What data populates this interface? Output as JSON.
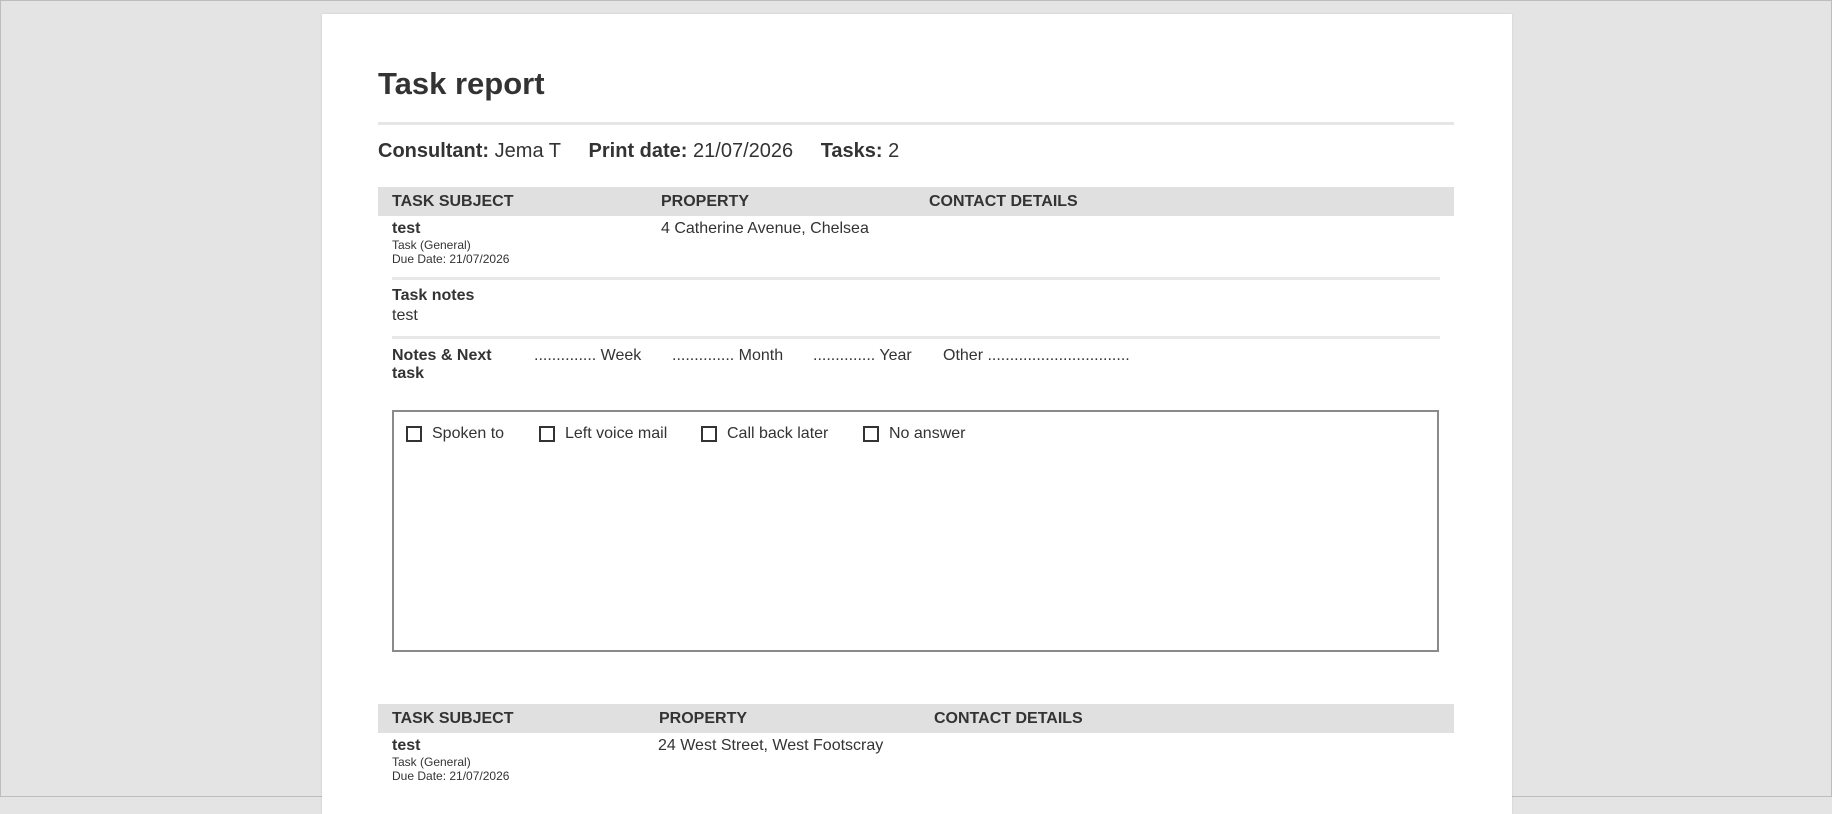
{
  "report": {
    "title": "Task report",
    "consultant_label": "Consultant:",
    "consultant_value": "Jema T",
    "print_date_label": "Print date:",
    "print_date_value": "21/07/2026",
    "tasks_label": "Tasks:",
    "tasks_value": "2"
  },
  "table_headers": [
    "TASK SUBJECT",
    "PROPERTY",
    "CONTACT DETAILS"
  ],
  "tasks": [
    {
      "subject": "test",
      "type": "Task (General)",
      "due": "Due Date: 21/07/2026",
      "property": "4 Catherine Avenue, Chelsea",
      "notes_label": "Task notes",
      "notes": "test",
      "next_label": "Notes & Next task",
      "periods": [
        ".............. Week",
        ".............. Month",
        ".............. Year",
        "Other ................................"
      ],
      "options": [
        "Spoken to",
        "Left voice mail",
        "Call back later",
        "No answer"
      ]
    },
    {
      "subject": "test",
      "type": "Task (General)",
      "due": "Due Date: 21/07/2026",
      "property": "24 West Street, West Footscray"
    }
  ]
}
